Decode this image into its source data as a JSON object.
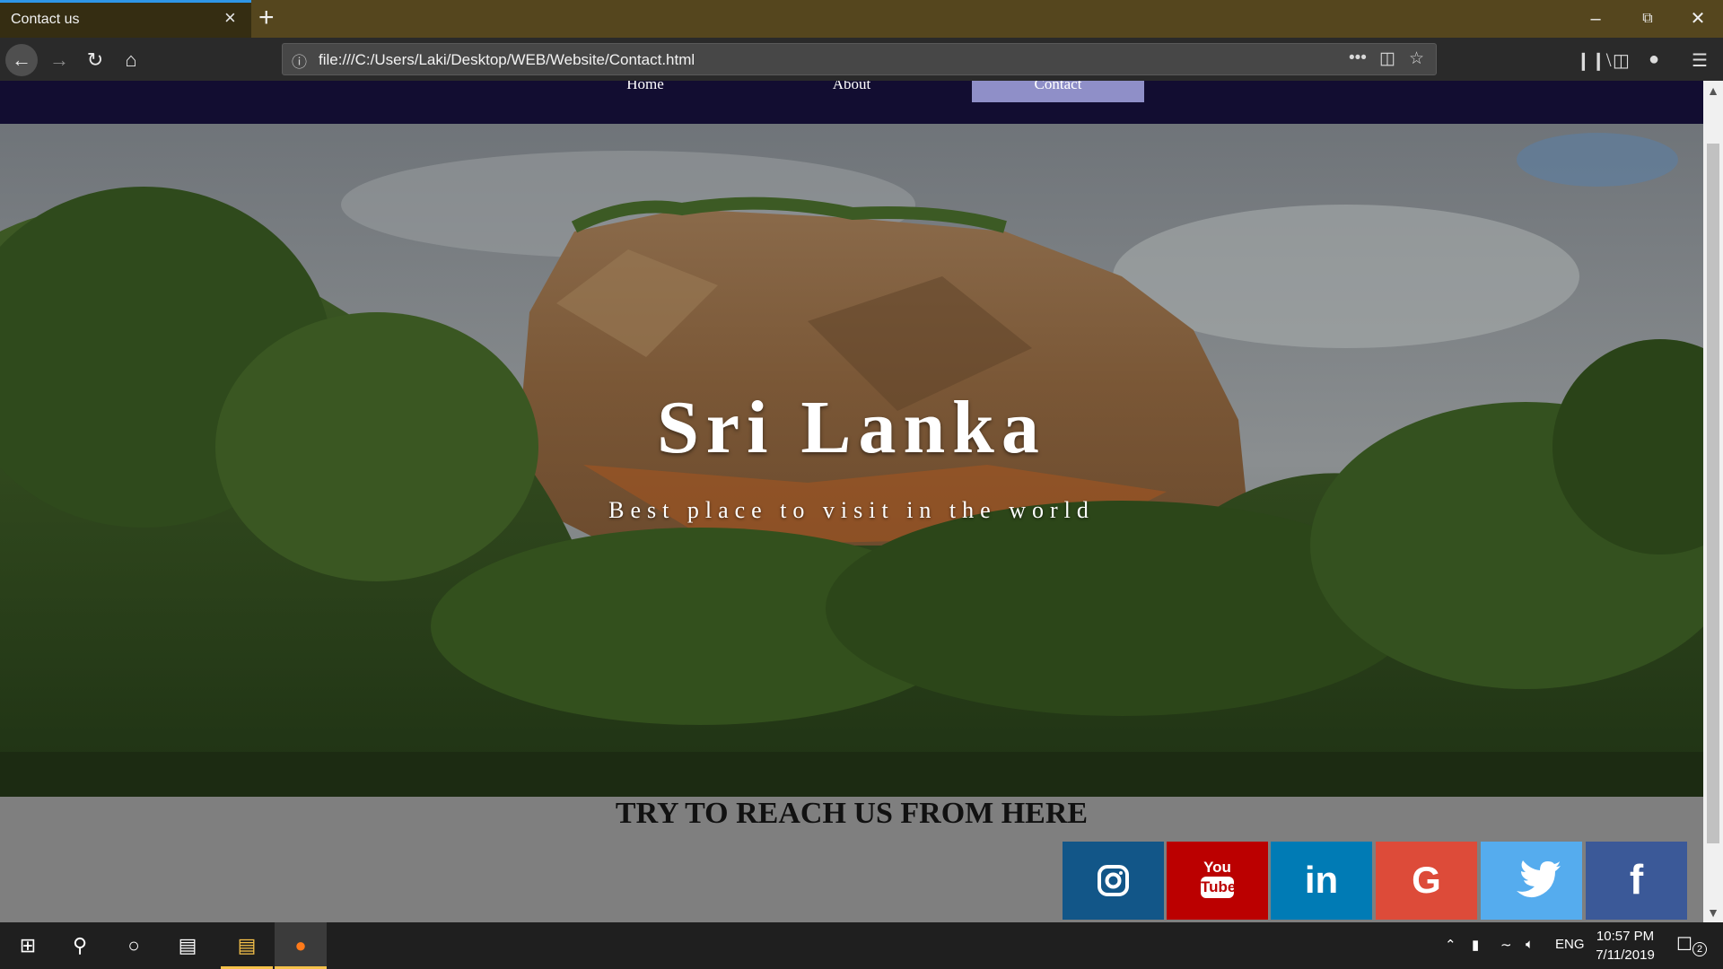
{
  "browser": {
    "tab_title": "Contact us",
    "url": "file:///C:/Users/Laki/Desktop/WEB/Website/Contact.html",
    "window_buttons": [
      "minimize",
      "restore",
      "close"
    ]
  },
  "site": {
    "nav": [
      {
        "label": "Home",
        "active": false
      },
      {
        "label": "About",
        "active": false
      },
      {
        "label": "Contact",
        "active": true
      }
    ],
    "hero_title": "Sri Lanka",
    "hero_subtitle": "Best place to visit in the world",
    "contact_heading": "TRY TO REACH US FROM HERE",
    "social": [
      {
        "name": "instagram",
        "color": "#125688"
      },
      {
        "name": "youtube",
        "color": "#bb0000",
        "label_top": "You",
        "label_bottom": "Tube"
      },
      {
        "name": "linkedin",
        "color": "#007bb5",
        "label": "in"
      },
      {
        "name": "google",
        "color": "#dd4b39",
        "label": "G"
      },
      {
        "name": "twitter",
        "color": "#55acee"
      },
      {
        "name": "facebook",
        "color": "#3b5998",
        "label": "f"
      }
    ]
  },
  "taskbar": {
    "language": "ENG",
    "time": "10:57 PM",
    "date": "7/11/2019",
    "notification_count": "2"
  },
  "colors": {
    "tabbar": "#55461e",
    "site_nav": "#120d31",
    "nav_active": "#8f8fc8",
    "contact_bg": "#7f7f7f"
  }
}
